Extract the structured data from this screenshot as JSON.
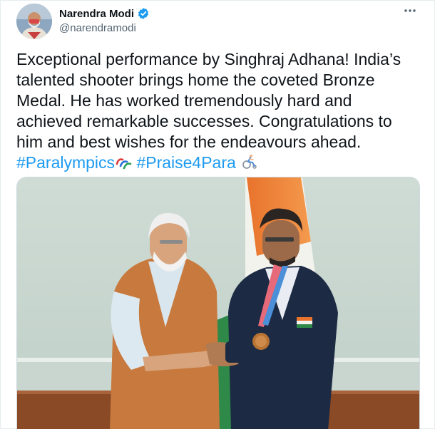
{
  "tweet": {
    "author": {
      "display_name": "Narendra Modi",
      "handle": "@narendramodi",
      "verified": true
    },
    "text_lines": [
      "Exceptional performance by Singhraj Adhana! India’s",
      "talented shooter brings home the coveted Bronze",
      "Medal. He has worked tremendously hard and",
      "achieved remarkable successes. Congratulations to",
      "him and best wishes for the endeavours ahead."
    ],
    "hashtags": [
      "#Paralympics",
      "#Praise4Para"
    ],
    "more_icon": "more-horizontal-icon",
    "emoji_icons": [
      "paralympics-agitos-icon",
      "wheelchair-racing-icon"
    ]
  },
  "colors": {
    "accent": "#1d9bf0",
    "text": "#0f1419",
    "secondary": "#536471"
  }
}
